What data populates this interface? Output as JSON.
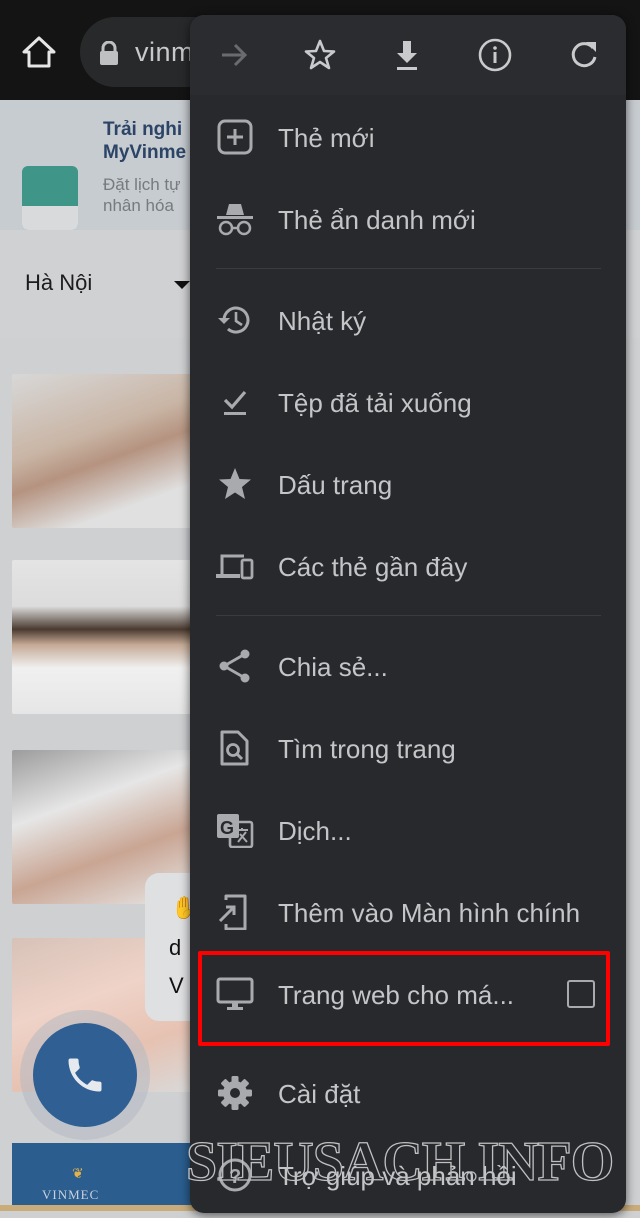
{
  "browser": {
    "url_fragment": "vinm",
    "icons": {
      "home": "home-icon",
      "lock": "lock-icon"
    }
  },
  "page": {
    "promo": {
      "title_line1": "Trải nghi",
      "title_line2": "MyVinme",
      "subtitle_line1": "Đặt lịch tự",
      "subtitle_line2": "nhân hóa"
    },
    "city_selector": {
      "value": "Hà Nội"
    },
    "chat_bubble": {
      "line1": "d",
      "line2": "V"
    },
    "banner": {
      "text": "VINMEC"
    }
  },
  "menu": {
    "toolbar": [
      {
        "name": "forward",
        "icon": "arrow-right-icon",
        "enabled": false
      },
      {
        "name": "bookmark",
        "icon": "star-outline-icon",
        "enabled": true
      },
      {
        "name": "download",
        "icon": "download-icon",
        "enabled": true
      },
      {
        "name": "page-info",
        "icon": "info-icon",
        "enabled": true
      },
      {
        "name": "reload",
        "icon": "refresh-icon",
        "enabled": true
      }
    ],
    "items": [
      {
        "label": "Thẻ mới",
        "icon": "new-tab-icon"
      },
      {
        "label": "Thẻ ẩn danh mới",
        "icon": "incognito-icon"
      },
      {
        "label": "Nhật ký",
        "icon": "history-icon"
      },
      {
        "label": "Tệp đã tải xuống",
        "icon": "downloads-check-icon"
      },
      {
        "label": "Dấu trang",
        "icon": "star-filled-icon"
      },
      {
        "label": "Các thẻ gần đây",
        "icon": "devices-icon"
      },
      {
        "label": "Chia sẻ...",
        "icon": "share-icon"
      },
      {
        "label": "Tìm trong trang",
        "icon": "find-in-page-icon"
      },
      {
        "label": "Dịch...",
        "icon": "translate-icon"
      },
      {
        "label": "Thêm vào Màn hình chính",
        "icon": "add-to-home-icon"
      },
      {
        "label": "Trang web cho má...",
        "icon": "desktop-icon",
        "checked": false
      },
      {
        "label": "Cài đặt",
        "icon": "gear-icon"
      },
      {
        "label": "Trợ giúp và phản hồi",
        "icon": "help-icon"
      }
    ],
    "highlight_color": "#ff0000"
  },
  "watermark": "SIEUSACH.INFO",
  "colors": {
    "menu_bg": "#28292c",
    "menu_text": "#c4c5c7",
    "icon": "#a9aaad",
    "call_button": "#2f5f93"
  }
}
